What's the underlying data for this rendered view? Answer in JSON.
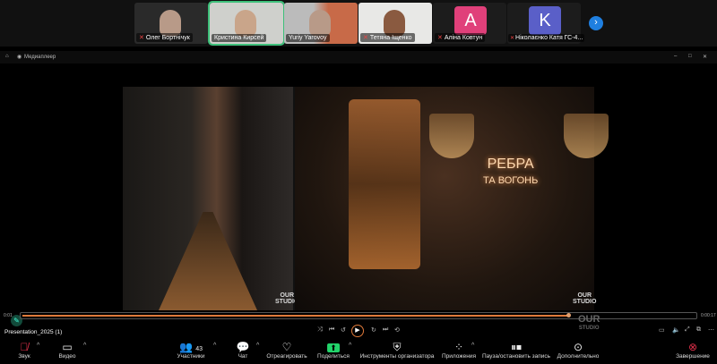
{
  "participants_strip": {
    "tiles": [
      {
        "name": "Олег Бортнічук",
        "muted": true
      },
      {
        "name": "Кристина Кирсей",
        "muted": false,
        "active": true
      },
      {
        "name": "Yuriy Yarovoy",
        "muted": false
      },
      {
        "name": "Тетяна Іщенко",
        "muted": true
      },
      {
        "name": "Аліна Ковтун",
        "muted": true,
        "avatar_letter": "A",
        "avatar_color": "#e0407a"
      },
      {
        "name": "Ніколаєнко Катя ГС-4...",
        "muted": true,
        "avatar_letter": "K",
        "avatar_color": "#5a5fc8"
      }
    ],
    "next_icon": "chevron-right-icon"
  },
  "window": {
    "title": "Медиаплеер"
  },
  "slide": {
    "sign_line1": "РЕБРА",
    "sign_line2": "ТА ВОГОНЬ",
    "logo_left": "OUR STUDIO",
    "logo_right": "OUR STUDIO"
  },
  "player": {
    "time_elapsed": "0:01",
    "time_total": "0:00:17",
    "progress_percent": 81,
    "file_name": "Presentation_2025 (1)",
    "watermark_line1": "OUR",
    "watermark_line2": "STUDIO"
  },
  "toolbar": {
    "audio": "Звук",
    "video": "Видео",
    "participants": "Участники",
    "participants_count": "43",
    "chat": "Чат",
    "react": "Отреагировать",
    "share": "Поделиться",
    "host_tools": "Инструменты организатора",
    "apps": "Приложения",
    "record": "Пауза/остановить запись",
    "more": "Дополнительно",
    "end": "Завершение"
  },
  "colors": {
    "accent": "#e07a3a",
    "share_green": "#22d46a",
    "active_border": "#3ec07a",
    "end_red": "#e0304a"
  }
}
